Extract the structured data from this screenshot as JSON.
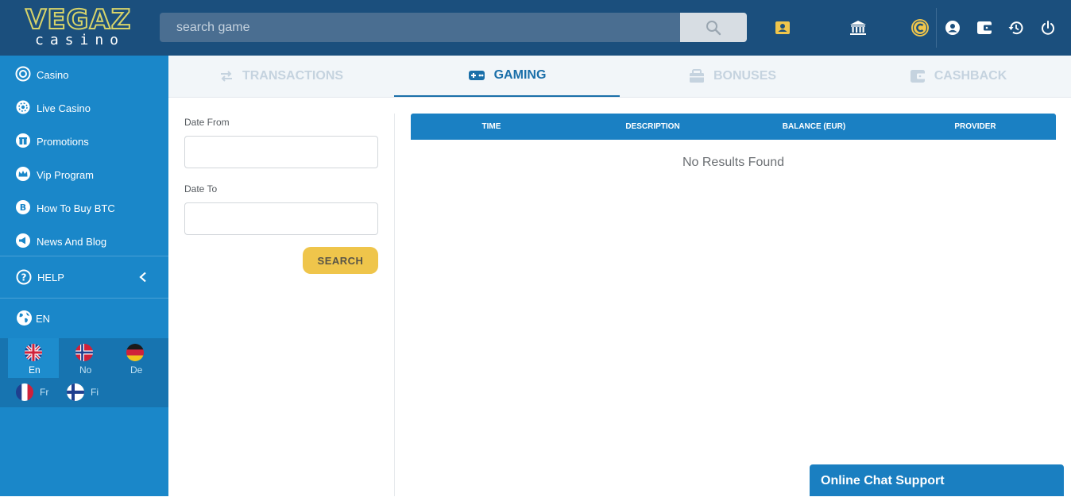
{
  "brand": {
    "name": "VEGAZ",
    "sub": "casino"
  },
  "search": {
    "placeholder": "search game"
  },
  "header_icons": [
    "id-card-icon",
    "bank-icon",
    "bonus-coin-icon",
    "account-icon",
    "wallet-icon",
    "history-icon",
    "power-icon"
  ],
  "sidebar": {
    "items": [
      {
        "label": "Casino",
        "icon": "casino-chip-icon"
      },
      {
        "label": "Live Casino",
        "icon": "live-casino-icon"
      },
      {
        "label": "Promotions",
        "icon": "gift-icon"
      },
      {
        "label": "Vip Program",
        "icon": "crown-icon"
      },
      {
        "label": "How To Buy BTC",
        "icon": "bitcoin-icon"
      },
      {
        "label": "News And Blog",
        "icon": "megaphone-icon"
      }
    ],
    "help": "HELP",
    "language": "EN",
    "languages": [
      {
        "code": "En",
        "active": true
      },
      {
        "code": "No",
        "active": false
      },
      {
        "code": "De",
        "active": false
      },
      {
        "code": "Fr",
        "active": false
      },
      {
        "code": "Fi",
        "active": false
      }
    ]
  },
  "tabs": [
    {
      "label": "TRANSACTIONS",
      "active": false
    },
    {
      "label": "GAMING",
      "active": true
    },
    {
      "label": "BONUSES",
      "active": false
    },
    {
      "label": "CASHBACK",
      "active": false
    }
  ],
  "filters": {
    "date_from": "Date From",
    "date_to": "Date To",
    "search_button": "SEARCH"
  },
  "table": {
    "columns": [
      "TIME",
      "DESCRIPTION",
      "BALANCE (EUR)",
      "PROVIDER"
    ],
    "empty_message": "No Results Found"
  },
  "chat": {
    "label": "Online Chat Support"
  },
  "colors": {
    "header": "#1b4f7d",
    "sidebar": "#1a87c9",
    "accent": "#efc54b",
    "active_tab": "#1a6fa9"
  }
}
